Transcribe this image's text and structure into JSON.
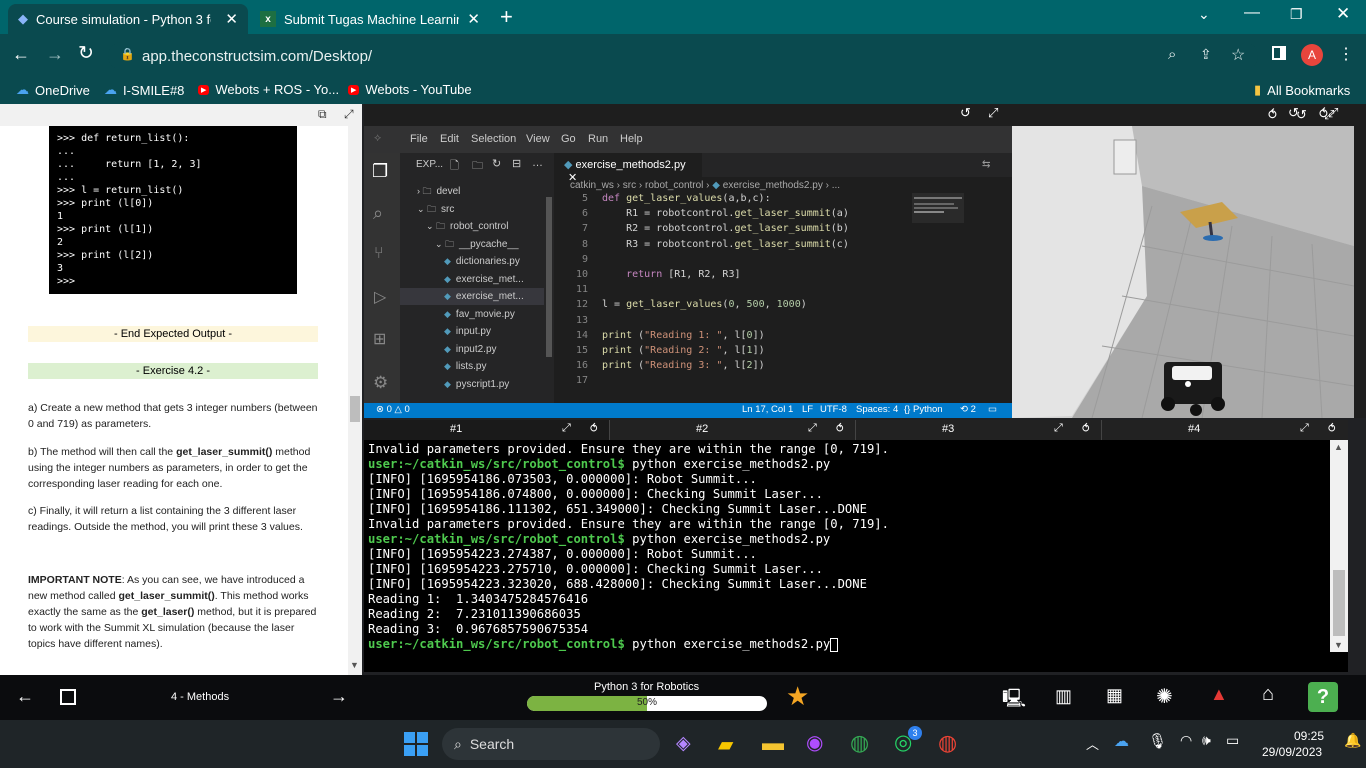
{
  "browser": {
    "tabs": [
      {
        "title": "Course simulation - Python 3 for",
        "active": true
      },
      {
        "title": "Submit Tugas Machine Learning",
        "active": false
      }
    ],
    "url": "app.theconstructsim.com/Desktop/",
    "profile_initial": "A",
    "bookmarks": [
      "OneDrive",
      "I-SMILE#8",
      "Webots + ROS - Yo...",
      "Webots - YouTube"
    ],
    "all_bookmarks": "All Bookmarks"
  },
  "lesson": {
    "code_lines": [
      ">>> def return_list():",
      "...",
      "...     return [1, 2, 3]",
      "...",
      ">>> l = return_list()",
      ">>> print (l[0])",
      "1",
      ">>> print (l[1])",
      "2",
      ">>> print (l[2])",
      "3",
      ">>>"
    ],
    "end_expected": "- End Expected Output -",
    "exercise_title": "- Exercise 4.2 -",
    "para_a": "a) Create a new method that gets 3 integer numbers (between 0 and 719) as parameters.",
    "para_b_pre": "b) The method will then call the ",
    "para_b_bold": "get_laser_summit()",
    "para_b_post": " method using the integer numbers as parameters, in order to get the corresponding laser reading for each one.",
    "para_c": "c) Finally, it will return a list containing the 3 different laser readings. Outside the method, you will print these 3 values.",
    "note_bold": "IMPORTANT NOTE",
    "note_1": ": As you can see, we have introduced a new method called ",
    "note_m1": "get_laser_summit()",
    "note_2": ". This method works exactly the same as the ",
    "note_m2": "get_laser()",
    "note_3": " method, but it is prepared to work with the Summit XL simulation (because the laser topics have different names)."
  },
  "vscode": {
    "menu": [
      "File",
      "Edit",
      "Selection",
      "View",
      "Go",
      "Run",
      "Help"
    ],
    "explorer_title": "EXP...",
    "tree": [
      {
        "label": "devel",
        "indent": 1,
        "type": "folder-closed"
      },
      {
        "label": "src",
        "indent": 1,
        "type": "folder-open"
      },
      {
        "label": "robot_control",
        "indent": 2,
        "type": "folder-open"
      },
      {
        "label": "__pycache__",
        "indent": 3,
        "type": "folder-open"
      },
      {
        "label": "dictionaries.py",
        "indent": 4,
        "type": "file"
      },
      {
        "label": "exercise_met...",
        "indent": 4,
        "type": "file"
      },
      {
        "label": "exercise_met...",
        "indent": 4,
        "type": "file-selected"
      },
      {
        "label": "fav_movie.py",
        "indent": 4,
        "type": "file"
      },
      {
        "label": "input.py",
        "indent": 4,
        "type": "file"
      },
      {
        "label": "input2.py",
        "indent": 4,
        "type": "file"
      },
      {
        "label": "lists.py",
        "indent": 4,
        "type": "file"
      },
      {
        "label": "pyscript1.py",
        "indent": 4,
        "type": "file"
      }
    ],
    "editor_tab": "exercise_methods2.py",
    "breadcrumb": [
      "catkin_ws",
      "src",
      "robot_control",
      "exercise_methods2.py",
      "..."
    ],
    "code": [
      {
        "n": "5",
        "t": "def get_laser_values(a,b,c):"
      },
      {
        "n": "6",
        "t": "    R1 = robotcontrol.get_laser_summit(a)"
      },
      {
        "n": "7",
        "t": "    R2 = robotcontrol.get_laser_summit(b)"
      },
      {
        "n": "8",
        "t": "    R3 = robotcontrol.get_laser_summit(c)"
      },
      {
        "n": "9",
        "t": ""
      },
      {
        "n": "10",
        "t": "    return [R1, R2, R3]"
      },
      {
        "n": "11",
        "t": ""
      },
      {
        "n": "12",
        "t": "l = get_laser_values(0, 500, 1000)"
      },
      {
        "n": "13",
        "t": ""
      },
      {
        "n": "14",
        "t": "print (\"Reading 1: \", l[0])"
      },
      {
        "n": "15",
        "t": "print (\"Reading 2: \", l[1])"
      },
      {
        "n": "16",
        "t": "print (\"Reading 3: \", l[2])"
      },
      {
        "n": "17",
        "t": ""
      }
    ],
    "status_left": "0 △ 0",
    "status_right": [
      "Ln 17, Col 1",
      "LF",
      "UTF-8",
      "Spaces: 4",
      "{} Python",
      "2"
    ]
  },
  "terminal": {
    "tabs": [
      "#1",
      "#2",
      "#3",
      "#4"
    ],
    "lines": [
      {
        "p": "",
        "t": "Invalid parameters provided. Ensure they are within the range [0, 719]."
      },
      {
        "p": "user:~/catkin_ws/src/robot_control$",
        "t": " python exercise_methods2.py"
      },
      {
        "p": "",
        "t": "[INFO] [1695954186.073503, 0.000000]: Robot Summit..."
      },
      {
        "p": "",
        "t": "[INFO] [1695954186.074800, 0.000000]: Checking Summit Laser..."
      },
      {
        "p": "",
        "t": "[INFO] [1695954186.111302, 651.349000]: Checking Summit Laser...DONE"
      },
      {
        "p": "",
        "t": "Invalid parameters provided. Ensure they are within the range [0, 719]."
      },
      {
        "p": "user:~/catkin_ws/src/robot_control$",
        "t": " python exercise_methods2.py"
      },
      {
        "p": "",
        "t": "[INFO] [1695954223.274387, 0.000000]: Robot Summit..."
      },
      {
        "p": "",
        "t": "[INFO] [1695954223.275710, 0.000000]: Checking Summit Laser..."
      },
      {
        "p": "",
        "t": "[INFO] [1695954223.323020, 688.428000]: Checking Summit Laser...DONE"
      },
      {
        "p": "",
        "t": "Reading 1:  1.3403475284576416"
      },
      {
        "p": "",
        "t": "Reading 2:  7.231011390686035"
      },
      {
        "p": "",
        "t": "Reading 3:  0.9676857590675354"
      },
      {
        "p": "user:~/catkin_ws/src/robot_control$",
        "t": " python exercise_methods2.py"
      }
    ]
  },
  "course": {
    "unit": "4 - Methods",
    "title": "Python 3 for Robotics",
    "progress_label": "50%",
    "progress": 0.5,
    "help": "?"
  },
  "taskbar": {
    "search": "Search",
    "time": "09:25",
    "date": "29/09/2023",
    "whatsapp_badge": "3"
  },
  "colors": {
    "accent": "#00656b",
    "progress": "#7cb342",
    "vscode_status": "#007acc"
  }
}
